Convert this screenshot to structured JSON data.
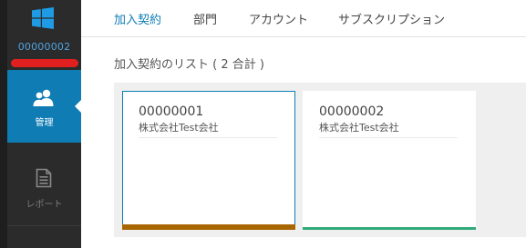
{
  "rail": {
    "logo_icon": "windows-logo-icon",
    "account_id": "00000002",
    "items": [
      {
        "label": "管理",
        "icon": "users-icon",
        "active": true
      },
      {
        "label": "レポート",
        "icon": "report-document-icon",
        "active": false
      }
    ]
  },
  "tabs": [
    {
      "label": "加入契約",
      "active": true
    },
    {
      "label": "部門",
      "active": false
    },
    {
      "label": "アカウント",
      "active": false
    },
    {
      "label": "サブスクリプション",
      "active": false
    }
  ],
  "main": {
    "list_title": "加入契約のリスト ( 2 合計 )",
    "cards": [
      {
        "id": "00000001",
        "name": "株式会社Test会社",
        "accent": "#a86600",
        "selected": true
      },
      {
        "id": "00000002",
        "name": "株式会社Test会社",
        "accent": "#2faa7a",
        "selected": false
      }
    ]
  },
  "colors": {
    "rail_bg": "#2b2b2b",
    "accent": "#0f7cb4",
    "redaction": "#e02020"
  }
}
